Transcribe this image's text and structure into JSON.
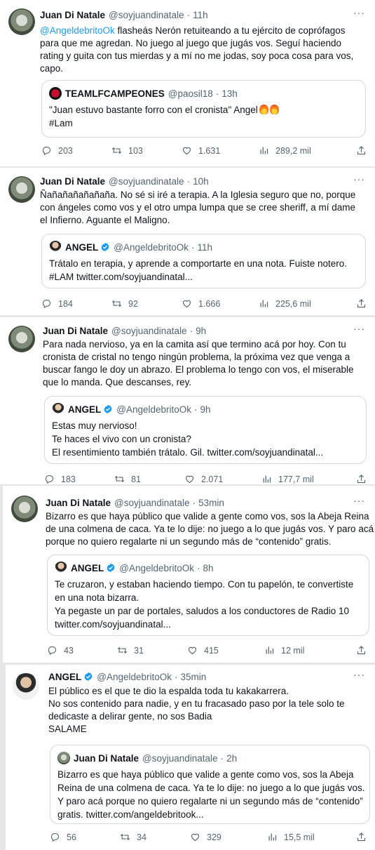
{
  "tweets": [
    {
      "name": "Juan Di Natale",
      "handle": "@soyjuandinatale",
      "time": "11h",
      "lines": [
        "",
        "para que me agredan. No juego al juego que jugás vos. Seguí haciendo",
        "rating y guita con tus mierdas y a mí no me jodas, soy poca cosa para vos,",
        "capo."
      ],
      "mention": "@AngeldebritoOk",
      "first_line_rest": " flasheás Nerón retuiteando a tu ejército de coprófagos",
      "quote": {
        "name": "TEAMLFCAMPEONES",
        "handle": "@paosil18",
        "time": "13h",
        "lines": [
          "\"Juan estuvo bastante forro con el cronista\" Angel",
          "#Lam"
        ]
      },
      "stats": {
        "replies": "203",
        "retweets": "103",
        "likes": "1.631",
        "views": "289,2 mil"
      }
    },
    {
      "name": "Juan Di Natale",
      "handle": "@soyjuandinatale",
      "time": "10h",
      "lines": [
        "Ñañañañañañaña. No sé si iré a terapia. A la Iglesia seguro que no, porque",
        "con ángeles como vos y el otro  umpa lumpa que se cree sheriff, a mí dame",
        "el Infierno. Aguante el Maligno."
      ],
      "quote": {
        "name": "ANGEL",
        "handle": "@AngeldebritoOk",
        "time": "11h",
        "lines": [
          "Trátalo en terapia, y aprende a comportarte en una nota. Fuiste notero.",
          "#LAM twitter.com/soyjuandinatal..."
        ]
      },
      "stats": {
        "replies": "184",
        "retweets": "92",
        "likes": "1.666",
        "views": "225,6 mil"
      }
    },
    {
      "name": "Juan Di Natale",
      "handle": "@soyjuandinatale",
      "time": "9h",
      "lines": [
        "Para nada nervioso, ya en la camita así que termino acá por hoy. Con tu",
        "cronista de cristal no tengo ningún problema, la próxima vez que venga a",
        "buscar fango le doy un abrazo. El problema lo tengo con vos, el miserable",
        "que lo manda. Que descanses, rey."
      ],
      "quote": {
        "name": "ANGEL",
        "handle": "@AngeldebritoOk",
        "time": "9h",
        "lines": [
          "Estas muy nervioso!",
          "Te haces el vivo con un cronista?",
          "El resentimiento también trátalo. Gil. twitter.com/soyjuandinatal..."
        ]
      },
      "stats": {
        "replies": "183",
        "retweets": "81",
        "likes": "2.071",
        "views": "177,7 mil"
      }
    },
    {
      "name": "Juan Di Natale",
      "handle": "@soyjuandinatale",
      "time": "53min",
      "lines": [
        "Bizarro es que haya público que valide a gente como vos, sos la Abeja Reina",
        "de una colmena de caca. Ya te lo dije: no juego a lo que jugás vos. Y paro acá",
        "porque no quiero regalarte ni un segundo más de “contenido” gratis."
      ],
      "quote": {
        "name": "ANGEL",
        "handle": "@AngeldebritoOk",
        "time": "8h",
        "lines": [
          "Te cruzaron, y estaban haciendo tiempo. Con tu papelón, te convertiste",
          "en una nota bizarra.",
          "Ya pegaste un par de portales, saludos a los conductores de Radio 10",
          "twitter.com/soyjuandinatal..."
        ]
      },
      "stats": {
        "replies": "43",
        "retweets": "31",
        "likes": "415",
        "views": "12 mil"
      }
    },
    {
      "name": "ANGEL",
      "handle": "@AngeldebritoOk",
      "time": "35min",
      "lines": [
        "El público es el que te dio la espalda toda tu kakakarrera.",
        "No sos contenido para nadie, y en tu fracasado paso por la tele solo te",
        "dedicaste a delirar gente, no sos Badia",
        "SALAME"
      ],
      "quote": {
        "name": "Juan Di Natale",
        "handle": "@soyjuandinatale",
        "time": "2h",
        "lines": [
          "Bizarro es que haya público que valide a gente como vos, sos la Abeja",
          "Reina de una colmena de caca. Ya te lo dije: no juego a lo que jugás vos.",
          "Y paro acá porque no quiero regalarte ni un segundo más de “contenido”",
          "gratis. twitter.com/angeldebritook..."
        ]
      },
      "stats": {
        "replies": "56",
        "retweets": "34",
        "likes": "329",
        "views": "15,5 mil"
      }
    }
  ],
  "icons": {
    "reply": "reply-icon",
    "retweet": "retweet-icon",
    "like": "heart-icon",
    "views": "views-icon",
    "share": "share-icon",
    "more": "more-icon",
    "verified": "verified-badge-icon"
  },
  "colors": {
    "link": "#1d9bf0",
    "muted": "#536471",
    "verified": "#1d9bf0"
  },
  "ui": {
    "more_label": "···"
  }
}
